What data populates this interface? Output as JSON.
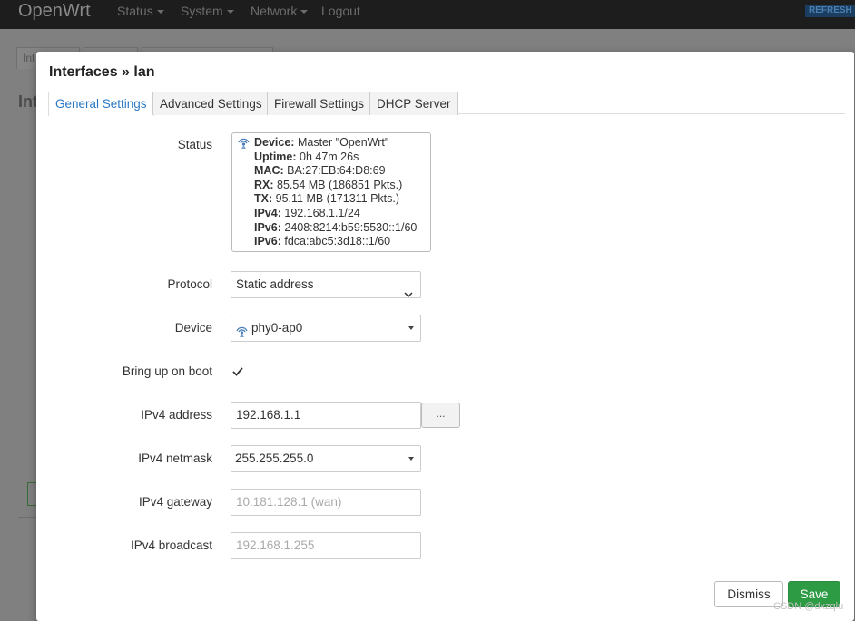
{
  "navbar": {
    "brand": "OpenWrt",
    "menu": [
      {
        "label": "Status"
      },
      {
        "label": "System"
      },
      {
        "label": "Network"
      },
      {
        "label": "Logout"
      }
    ],
    "refresh_badge": "REFRESH"
  },
  "background": {
    "tabs": [
      "Int",
      "",
      ""
    ],
    "heading": "Int"
  },
  "modal": {
    "title": "Interfaces » lan",
    "tabs": [
      {
        "label": "General Settings",
        "active": true
      },
      {
        "label": "Advanced Settings",
        "active": false
      },
      {
        "label": "Firewall Settings",
        "active": false
      },
      {
        "label": "DHCP Server",
        "active": false
      }
    ],
    "status": {
      "label": "Status",
      "lines": [
        {
          "key": "Device:",
          "value": "Master \"OpenWrt\""
        },
        {
          "key": "Uptime:",
          "value": "0h 47m 26s"
        },
        {
          "key": "MAC:",
          "value": "BA:27:EB:64:D8:69"
        },
        {
          "key": "RX:",
          "value": "85.54 MB (186851 Pkts.)"
        },
        {
          "key": "TX:",
          "value": "95.11 MB (171311 Pkts.)"
        },
        {
          "key": "IPv4:",
          "value": "192.168.1.1/24"
        },
        {
          "key": "IPv6:",
          "value": "2408:8214:b59:5530::1/60"
        },
        {
          "key": "IPv6:",
          "value": "fdca:abc5:3d18::1/60"
        }
      ]
    },
    "protocol": {
      "label": "Protocol",
      "value": "Static address"
    },
    "device": {
      "label": "Device",
      "value": "phy0-ap0"
    },
    "bring_up": {
      "label": "Bring up on boot",
      "checked": true
    },
    "ipv4_address": {
      "label": "IPv4 address",
      "value": "192.168.1.1",
      "more_label": "..."
    },
    "ipv4_netmask": {
      "label": "IPv4 netmask",
      "value": "255.255.255.0"
    },
    "ipv4_gateway": {
      "label": "IPv4 gateway",
      "placeholder": "10.181.128.1 (wan)"
    },
    "ipv4_broadcast": {
      "label": "IPv4 broadcast",
      "placeholder": "192.168.1.255"
    },
    "buttons": {
      "dismiss": "Dismiss",
      "save": "Save"
    }
  },
  "watermark": "CSDN @dxzqlu",
  "colors": {
    "accent": "#2a77c5",
    "save": "#2d9a44",
    "navbar": "#1d1d1d"
  }
}
